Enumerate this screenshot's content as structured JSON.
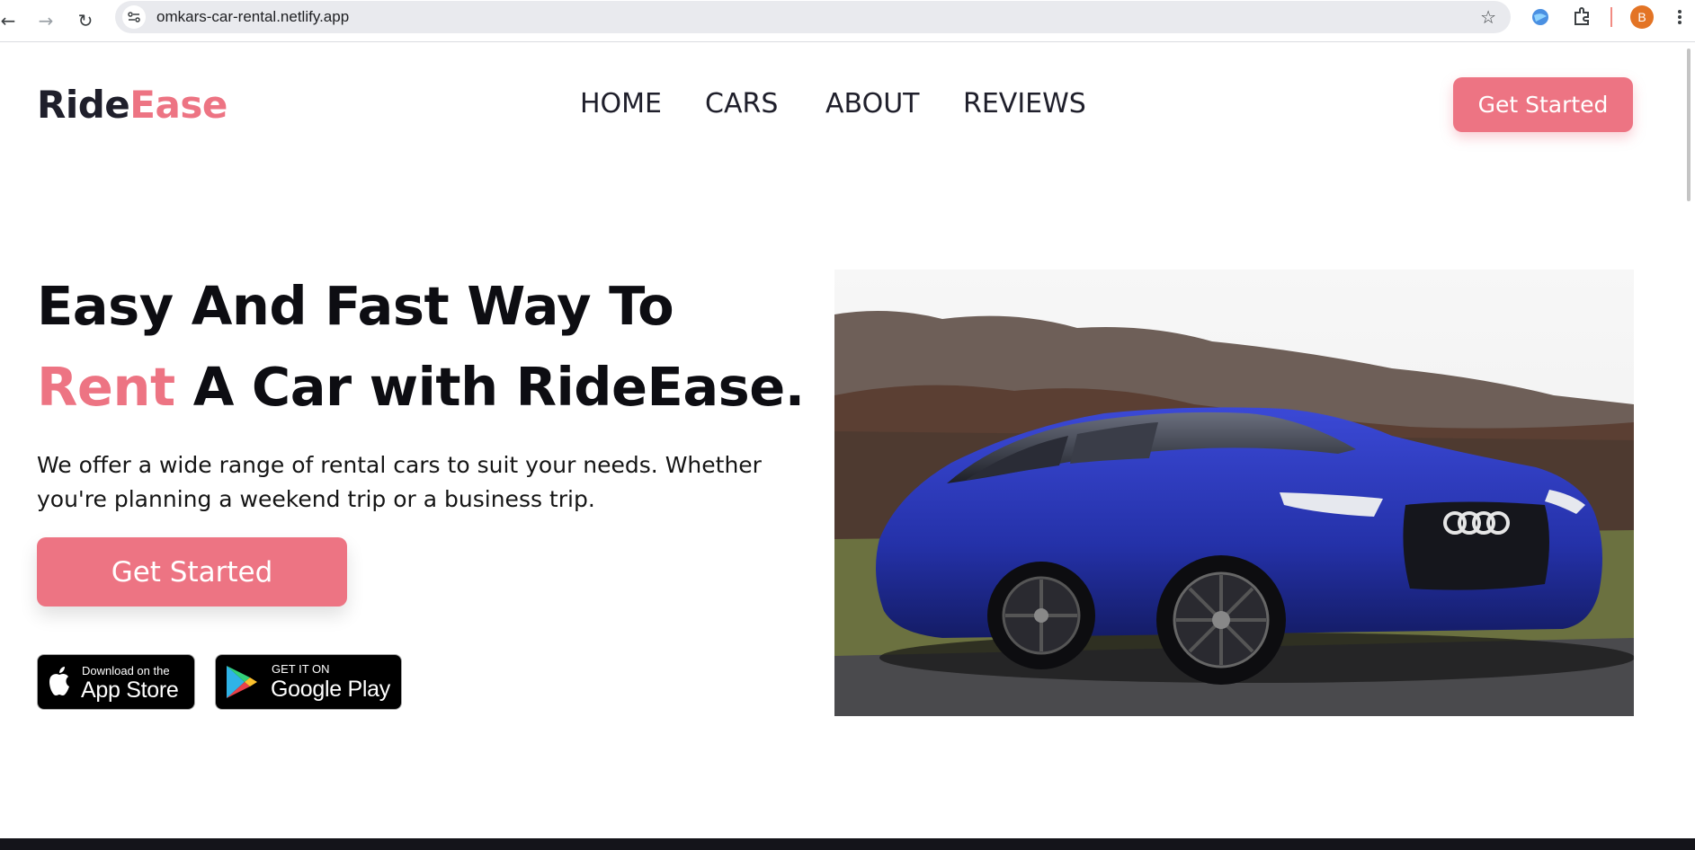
{
  "browser": {
    "url": "omkars-car-rental.netlify.app",
    "profile_initial": "B"
  },
  "site": {
    "logo_part1": "Ride",
    "logo_part2": "Ease",
    "nav": [
      "HOME",
      "CARS",
      "ABOUT",
      "REVIEWS"
    ],
    "header_cta": "Get Started"
  },
  "hero": {
    "title_line1": "Easy And Fast Way To",
    "title_accent": "Rent",
    "title_line2_rest": " A Car with RideEase.",
    "description": "We offer a wide range of rental cars to suit your needs. Whether you're planning a weekend trip or a business trip.",
    "cta": "Get Started",
    "app_store_small": "Download on the",
    "app_store_big": "App Store",
    "google_play_small": "GET IT ON",
    "google_play_big": "Google Play"
  },
  "colors": {
    "accent": "#ed7483",
    "text_dark": "#1f1f2b",
    "car": "#2a36b8"
  }
}
